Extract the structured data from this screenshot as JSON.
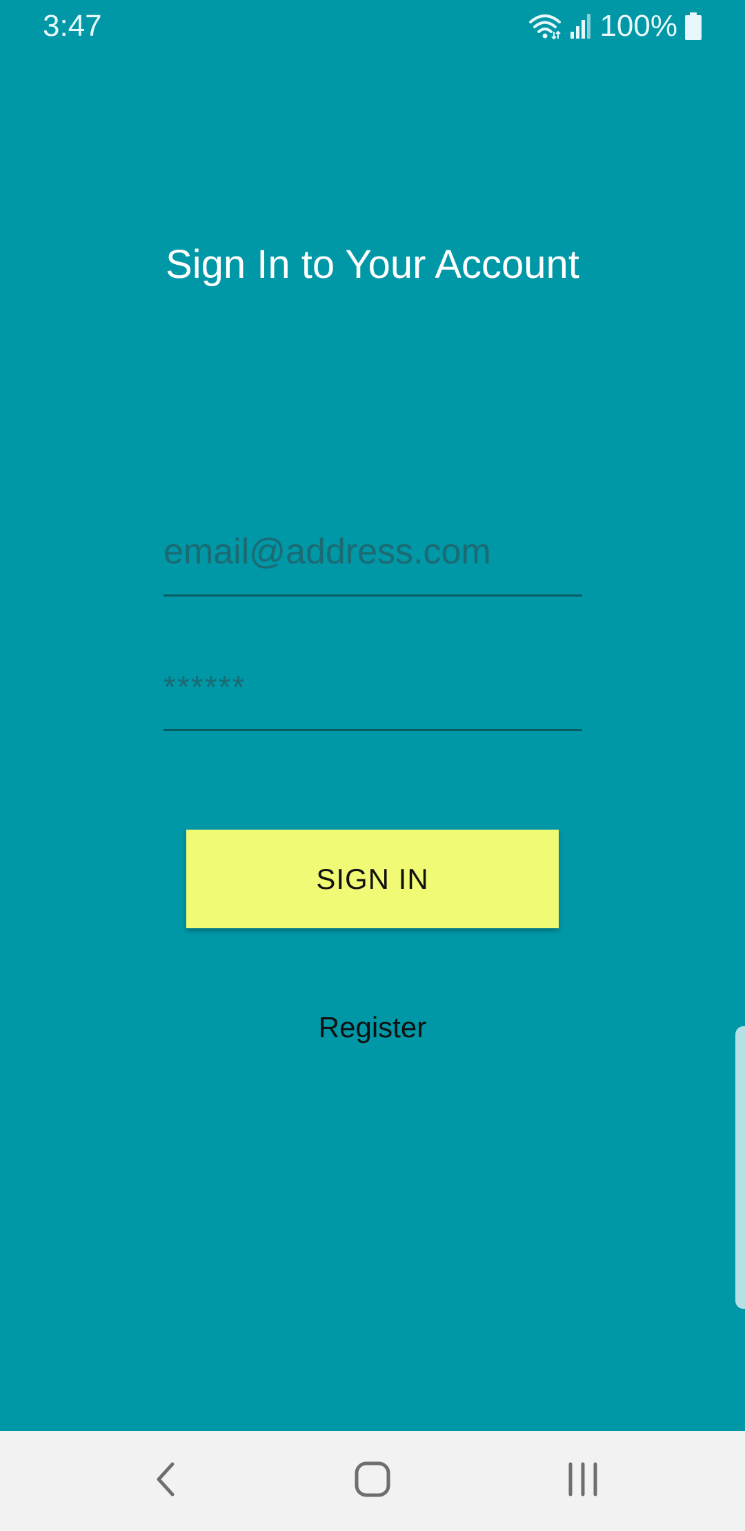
{
  "status_bar": {
    "time": "3:47",
    "battery_percent": "100%",
    "icons": [
      "wifi-icon",
      "signal-icon",
      "battery-icon"
    ]
  },
  "login": {
    "title": "Sign In to Your Account",
    "email": {
      "value": "",
      "placeholder": "email@address.com"
    },
    "password": {
      "value": "",
      "placeholder": "******"
    },
    "sign_in_label": "SIGN IN",
    "register_label": "Register"
  },
  "nav_bar": {
    "icons": [
      "back-icon",
      "home-icon",
      "recents-icon"
    ]
  },
  "colors": {
    "background": "#0097a7",
    "button": "#f0fa75",
    "nav_bar": "#f2f2f2"
  }
}
